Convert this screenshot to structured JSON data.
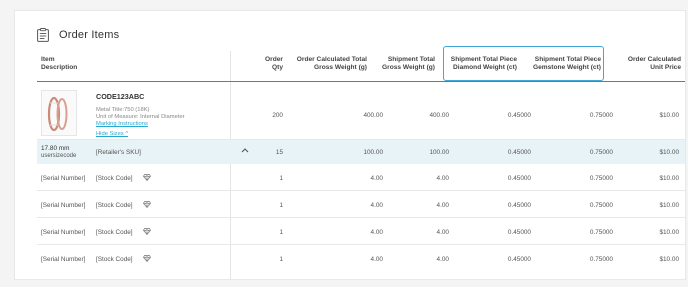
{
  "header": {
    "title": "Order Items",
    "icon": "clipboard-list-icon"
  },
  "columns": {
    "item": "Item",
    "description": "Description",
    "order_qty_1": "Order",
    "order_qty_2": "Qty",
    "calc_gross_1": "Order Calculated Total",
    "calc_gross_2": "Gross Weight (g)",
    "ship_gross_1": "Shipment Total",
    "ship_gross_2": "Gross Weight (g)",
    "diamond_1": "Shipment Total Piece",
    "diamond_2": "Diamond Weight (ct)",
    "gemstone_1": "Shipment Total Piece",
    "gemstone_2": "Gemstone Weight (ct)",
    "unit_price_1": "Order Calculated",
    "unit_price_2": "Unit Price"
  },
  "product": {
    "code": "CODE123ABC",
    "metal": "Metal Title:750 (18K)",
    "unit": "Unit of Measure: Internal Diameter",
    "marking_link": "Marking Instructions",
    "hide_sizes": "Hide Sizes ^",
    "qty": "200",
    "calc_gross": "400.00",
    "ship_gross": "400.00",
    "diamond": "0.45000",
    "gemstone": "0.75000",
    "unit_price": "$10.00"
  },
  "size_row": {
    "size": "17.80 mm",
    "size_code": "usersizecode",
    "sku": "[Retailer's SKU]",
    "qty": "15",
    "calc_gross": "100.00",
    "ship_gross": "100.00",
    "diamond": "0.45000",
    "gemstone": "0.75000",
    "unit_price": "$10.00"
  },
  "serial_rows": [
    {
      "serial": "[Serial Number]",
      "stock": "[Stock Code]",
      "qty": "1",
      "calc_gross": "4.00",
      "ship_gross": "4.00",
      "diamond": "0.45000",
      "gemstone": "0.75000",
      "unit_price": "$10.00"
    },
    {
      "serial": "[Serial Number]",
      "stock": "[Stock Code]",
      "qty": "1",
      "calc_gross": "4.00",
      "ship_gross": "4.00",
      "diamond": "0.45000",
      "gemstone": "0.75000",
      "unit_price": "$10.00"
    },
    {
      "serial": "[Serial Number]",
      "stock": "[Stock Code]",
      "qty": "1",
      "calc_gross": "4.00",
      "ship_gross": "4.00",
      "diamond": "0.45000",
      "gemstone": "0.75000",
      "unit_price": "$10.00"
    },
    {
      "serial": "[Serial Number]",
      "stock": "[Stock Code]",
      "qty": "1",
      "calc_gross": "4.00",
      "ship_gross": "4.00",
      "diamond": "0.45000",
      "gemstone": "0.75000",
      "unit_price": "$10.00"
    }
  ],
  "colors": {
    "accent": "#3fa9d6",
    "link": "#2aa7cf",
    "size_row_bg": "#e8f3f7"
  }
}
